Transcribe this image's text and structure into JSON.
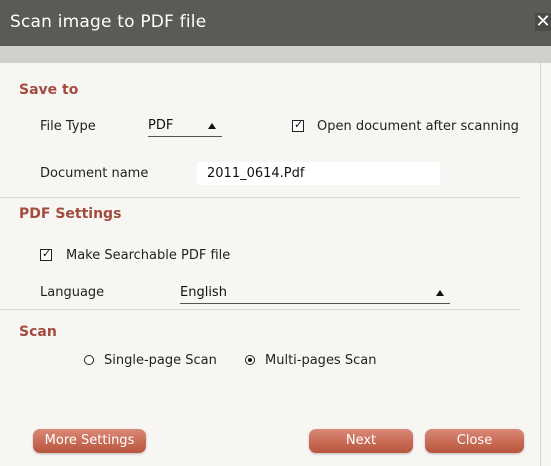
{
  "window": {
    "title": "Scan image to PDF file",
    "close_glyph": "✕"
  },
  "save_to": {
    "heading": "Save to",
    "file_type_label": "File Type",
    "file_type_value": "PDF",
    "open_after_label": "Open document after scanning",
    "open_after_checked": true,
    "doc_name_label": "Document name",
    "doc_name_value": "2011_0614.Pdf"
  },
  "pdf_settings": {
    "heading": "PDF Settings",
    "searchable_label": "Make Searchable PDF file",
    "searchable_checked": true,
    "language_label": "Language",
    "language_value": "English"
  },
  "scan": {
    "heading": "Scan",
    "single_label": "Single-page Scan",
    "multi_label": "Multi-pages Scan",
    "selected": "Multi-pages Scan"
  },
  "buttons": {
    "more_settings": "More Settings",
    "next": "Next",
    "close": "Close"
  },
  "colors": {
    "accent": "#a24b3e",
    "titlebar": "#5b5a57",
    "button": "#c86a55"
  }
}
